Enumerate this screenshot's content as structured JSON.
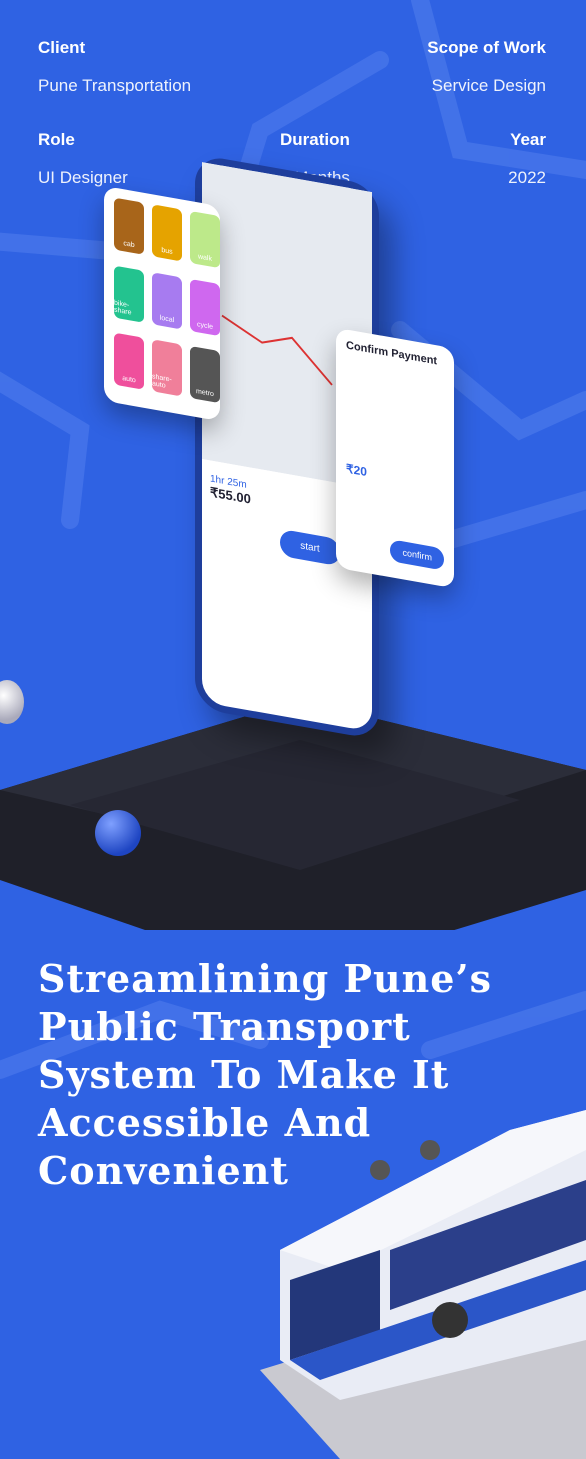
{
  "project": {
    "client_label": "Client",
    "client_value": "Pune Transportation",
    "scope_label": "Scope of Work",
    "scope_value": "Service Design",
    "role_label": "Role",
    "role_value": "UI Designer",
    "duration_label": "Duration",
    "duration_value": "3 Months",
    "year_label": "Year",
    "year_value": "2022"
  },
  "headline": "Streamlining Pune’s Public Transport System To Make It Accessible And Convenient",
  "mockup": {
    "tiles": [
      {
        "label": "cab",
        "color": "#a8651a"
      },
      {
        "label": "bus",
        "color": "#e5a300"
      },
      {
        "label": "walk",
        "color": "#bde98a"
      },
      {
        "label": "bike-share",
        "color": "#23c38f"
      },
      {
        "label": "local",
        "color": "#a77bf0"
      },
      {
        "label": "cycle",
        "color": "#cf68ef"
      },
      {
        "label": "auto",
        "color": "#ef4f9c"
      },
      {
        "label": "share-auto",
        "color": "#f07f9a"
      },
      {
        "label": "metro",
        "color": "#555"
      }
    ],
    "confirm_title": "Confirm Payment",
    "fare": "₹20",
    "confirm_button": "confirm",
    "start_button": "start",
    "total_time": "1hr 25m",
    "total_fare": "₹55.00"
  },
  "colors": {
    "background": "#2f62e3",
    "pedestal": "#22242e"
  }
}
